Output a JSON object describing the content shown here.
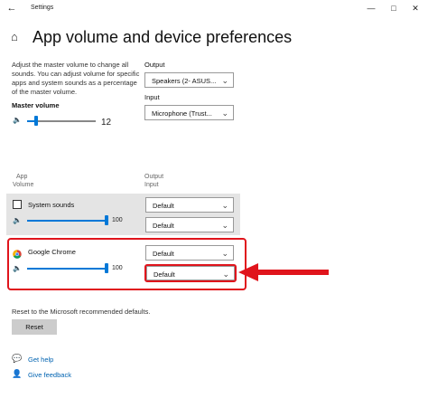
{
  "window": {
    "title": "Settings"
  },
  "header": {
    "title": "App volume and device preferences"
  },
  "master": {
    "description": "Adjust the master volume to change all sounds. You can adjust volume for specific apps and system sounds as a percentage of the master volume.",
    "label": "Master volume",
    "value": "12",
    "level": 0.12
  },
  "output": {
    "label": "Output",
    "selected": "Speakers (2- ASUS..."
  },
  "input": {
    "label": "Input",
    "selected": "Microphone (Trust..."
  },
  "columns": {
    "app": "App",
    "volume": "Volume",
    "output": "Output",
    "input": "Input"
  },
  "apps": [
    {
      "name": "System sounds",
      "value": "100",
      "level": 1.0,
      "output": "Default",
      "input": "Default"
    },
    {
      "name": "Google Chrome",
      "value": "100",
      "level": 1.0,
      "output": "Default",
      "input": "Default"
    }
  ],
  "reset": {
    "text": "Reset to the Microsoft recommended defaults.",
    "button": "Reset"
  },
  "links": {
    "help": "Get help",
    "feedback": "Give feedback"
  },
  "colors": {
    "accent": "#0078d7",
    "highlight": "#e0141c",
    "link": "#0063b1"
  },
  "icons": [
    "back-arrow-icon",
    "minimize-icon",
    "maximize-icon",
    "close-icon",
    "home-icon",
    "speaker-icon",
    "chevron-down-icon",
    "chrome-icon",
    "help-icon",
    "feedback-icon"
  ]
}
